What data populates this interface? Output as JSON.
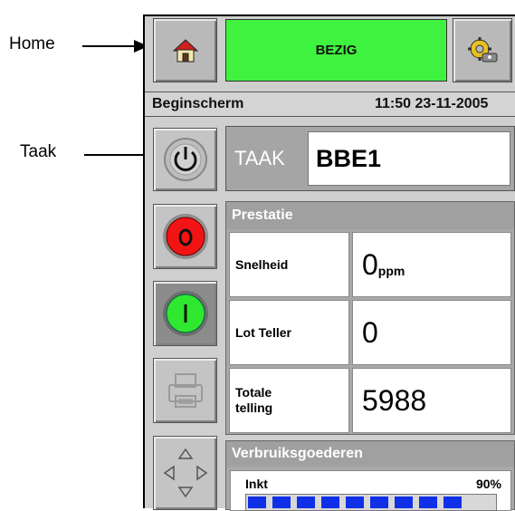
{
  "callouts": {
    "home": "Home",
    "taak": "Taak"
  },
  "header": {
    "status": "BEZIG",
    "status_color": "#3ff23f"
  },
  "info": {
    "screen_name": "Beginscherm",
    "datetime": "11:50 23-11-2005"
  },
  "job": {
    "label": "TAAK",
    "value": "BBE1"
  },
  "performance": {
    "title": "Prestatie",
    "rows": [
      {
        "label": "Snelheid",
        "value": "0",
        "unit": "ppm"
      },
      {
        "label": "Lot Teller",
        "value": "0",
        "unit": ""
      },
      {
        "label": "Totale telling",
        "value": "5988",
        "unit": ""
      }
    ]
  },
  "consumables": {
    "title": "Verbruiksgoederen",
    "ink_label": "Inkt",
    "ink_percent_text": "90%",
    "ink_level": 0.9
  },
  "icons": {
    "home": "home-icon",
    "settings": "settings-gear-icon",
    "power": "power-icon",
    "stop": "stop-icon",
    "start": "start-icon",
    "printer": "printer-icon",
    "navigation": "navigation-arrows-icon"
  }
}
